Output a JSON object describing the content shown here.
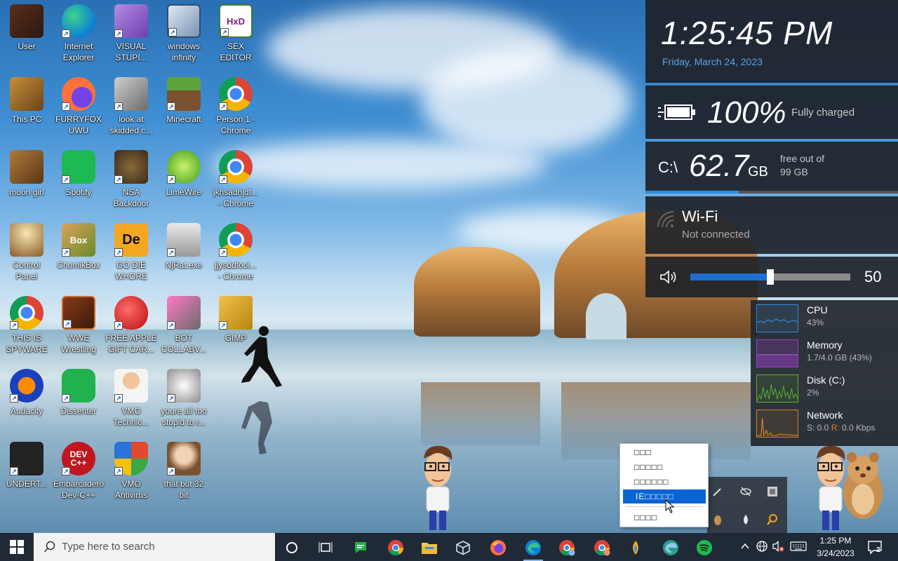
{
  "desktop": {
    "icons": [
      {
        "label": "User"
      },
      {
        "label": "Internet\nExplorer"
      },
      {
        "label": "VISUAL\nSTUPI..."
      },
      {
        "label": "windows\ninfinity"
      },
      {
        "label": "SEX\nEDITOR",
        "glyph": "HxD"
      },
      {
        "label": "This PC"
      },
      {
        "label": "FURRYFOX\nUWU"
      },
      {
        "label": "look at\nskidded c..."
      },
      {
        "label": "Minecraft"
      },
      {
        "label": "Person 1 -\nChrome"
      },
      {
        "label": "moon girl"
      },
      {
        "label": "Spotify"
      },
      {
        "label": "NSA\nBackdoor"
      },
      {
        "label": "LimeWire"
      },
      {
        "label": "jkhsadhjdf...\n- Chrome"
      },
      {
        "label": "Control\nPanel"
      },
      {
        "label": "ChomikBox",
        "glyph": "Box"
      },
      {
        "label": "GO DIE\nWHORE",
        "glyph": "De"
      },
      {
        "label": "NjRat.exe"
      },
      {
        "label": "jjysddfooi...\n- Chrome"
      },
      {
        "label": "THIS IS\nSPYWARE"
      },
      {
        "label": "WWE\nWrestling"
      },
      {
        "label": "FREE APPLE\nGIFT CAR..."
      },
      {
        "label": "BOT\nCOLLABV..."
      },
      {
        "label": "GIMP"
      },
      {
        "label": "Audacity"
      },
      {
        "label": "Dissenter"
      },
      {
        "label": "VMO\nTechnic..."
      },
      {
        "label": "youre all too\nstupid to r..."
      },
      {
        "label": "UNDERT..."
      },
      {
        "label": "Embarcadero\nDev-C++",
        "glyph": "DEV\nC++"
      },
      {
        "label": "VMO\nAntivirus"
      },
      {
        "label": "that but 32\nbit"
      }
    ]
  },
  "widgets": {
    "clock": {
      "time": "1:25:45 PM",
      "date": "Friday, March 24, 2023"
    },
    "battery": {
      "percent": "100%",
      "status": "Fully charged"
    },
    "disk": {
      "drive": "C:\\",
      "value": "62.7",
      "unit": "GB",
      "note_line1": "free out of",
      "note_line2": "99 GB",
      "used_fraction": 0.37
    },
    "wifi": {
      "title": "Wi-Fi",
      "status": "Not connected"
    },
    "volume": {
      "value": "50",
      "level_fraction": 0.5
    },
    "performance": [
      {
        "name": "CPU",
        "value": "43%",
        "color": "#2f8fe0"
      },
      {
        "name": "Memory",
        "value": "1.7/4.0 GB (43%)",
        "color": "#9b3fc8"
      },
      {
        "name": "Disk (C:)",
        "value": "2%",
        "color": "#5cb030"
      },
      {
        "name": "Network",
        "value_prefix": "S:",
        "value_s": " 0.0 ",
        "value_r_label": "R:",
        "value_r": " 0.0 Kbps",
        "color": "#d9822b"
      }
    ]
  },
  "context_menu": {
    "items": [
      "□□□",
      "□□□□□",
      "□□□□□□",
      "IE□□□□□",
      "□□□□"
    ],
    "selected_index": 3
  },
  "taskbar": {
    "search_placeholder": "Type here to search",
    "time": "1:25 PM",
    "date": "3/24/2023",
    "notification_count": "2"
  },
  "colors": {
    "taskbar_bg": "#1f2a36",
    "accent": "#0a64d6",
    "date_blue": "#5ba4e8",
    "volume_fill": "#1c6fd0"
  }
}
